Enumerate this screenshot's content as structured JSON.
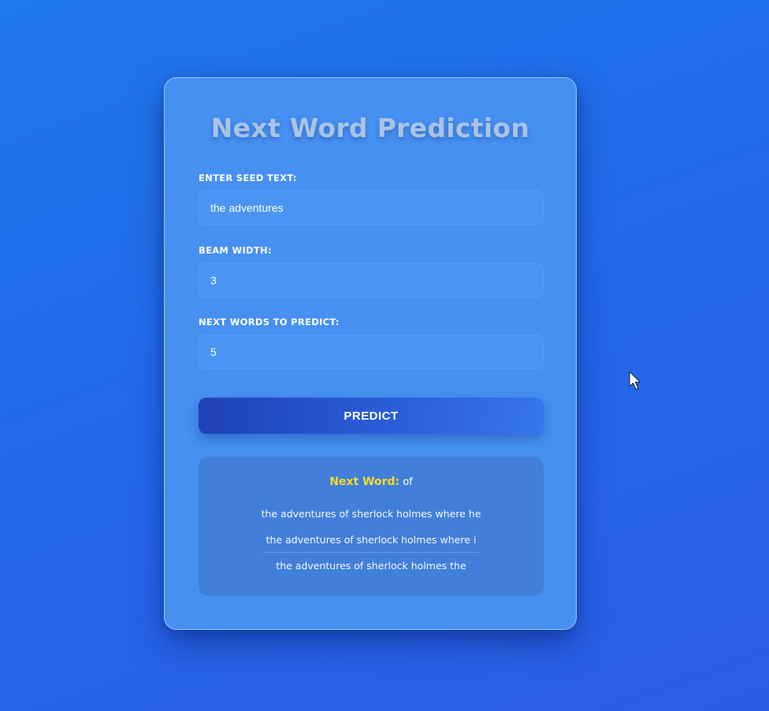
{
  "app": {
    "title": "Next Word Prediction"
  },
  "form": {
    "seed_label": "ENTER SEED TEXT:",
    "seed_value": "the adventures",
    "beam_label": "BEAM WIDTH:",
    "beam_value": "3",
    "next_words_label": "NEXT WORDS TO PREDICT:",
    "next_words_value": "5",
    "predict_label": "PREDICT"
  },
  "result": {
    "next_word_label": "Next Word:",
    "next_word_value": "of",
    "sequences": [
      "the adventures of sherlock holmes where he",
      "the adventures of sherlock holmes where i",
      "the adventures of sherlock holmes the"
    ]
  },
  "colors": {
    "background": "#2468ea",
    "card": "#4690f2",
    "accent_yellow": "#f5dc2a",
    "button_start": "#2041b5",
    "button_end": "#3676ef"
  },
  "icons": {
    "cursor": "mouse-pointer-icon"
  }
}
